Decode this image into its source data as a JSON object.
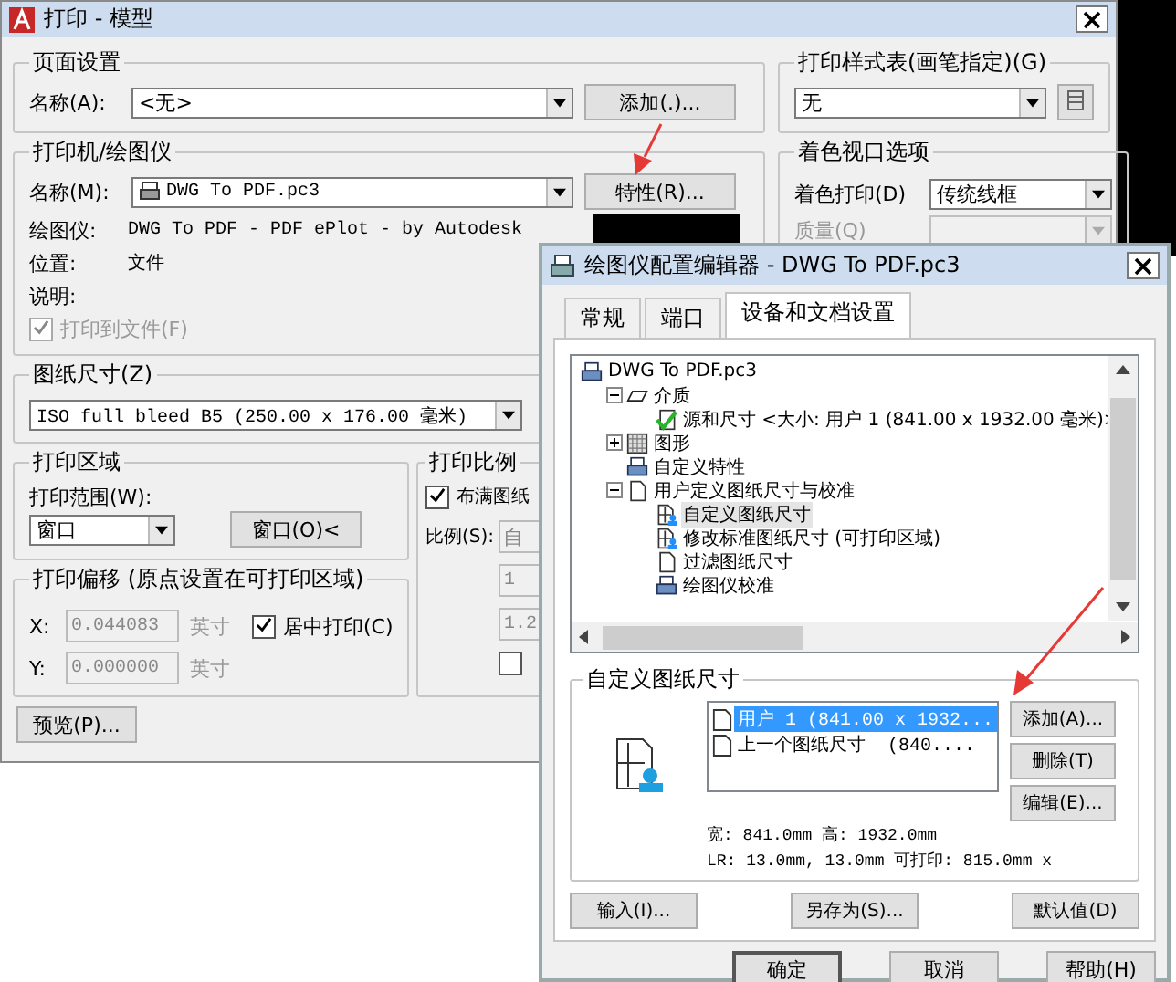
{
  "print_dialog": {
    "title": "打印 - 模型",
    "page_setup": {
      "title": "页面设置",
      "name_label": "名称(A):",
      "name_value": "<无>",
      "add_button": "添加(.)..."
    },
    "printer": {
      "title": "打印机/绘图仪",
      "name_label": "名称(M):",
      "name_value": "DWG To PDF.pc3",
      "properties_button": "特性(R)...",
      "info": [
        {
          "label": "绘图仪:",
          "value": "DWG To PDF - PDF ePlot - by Autodesk"
        },
        {
          "label": "位置:",
          "value": "文件"
        },
        {
          "label": "说明:"
        }
      ],
      "print_to_file": {
        "label": "打印到文件(F)",
        "checked": true,
        "disabled": true
      }
    },
    "paper_size": {
      "title": "图纸尺寸(Z)",
      "value": "ISO full bleed B5 (250.00 x 176.00 毫米)"
    },
    "print_area": {
      "title": "打印区域",
      "range_label": "打印范围(W):",
      "range_value": "窗口",
      "window_button": "窗口(O)<"
    },
    "print_offset": {
      "title": "打印偏移 (原点设置在可打印区域)",
      "fields": [
        {
          "label": "X:",
          "value": "0.044083",
          "unit": "英寸",
          "disabled": true
        },
        {
          "label": "Y:",
          "value": "0.000000",
          "unit": "英寸",
          "disabled": true
        }
      ],
      "center": {
        "label": "居中打印(C)",
        "checked": true
      }
    },
    "print_scale": {
      "title": "打印比例",
      "fit": {
        "label": "布满图纸",
        "checked": true
      },
      "scale_label": "比例(S):",
      "scale_value": "自",
      "fields": [
        "1",
        "1.2"
      ],
      "option": {
        "checked": false
      }
    },
    "preview_button": "预览(P)...",
    "plot_style": {
      "title": "打印样式表(画笔指定)(G)",
      "value": "无"
    },
    "shaded_viewport": {
      "title": "着色视口选项",
      "rows": [
        {
          "label": "着色打印(D)",
          "value": "传统线框",
          "disabled": false
        },
        {
          "label": "质量(Q)",
          "disabled": true
        }
      ]
    }
  },
  "editor_dialog": {
    "title": "绘图仪配置编辑器 - DWG To PDF.pc3",
    "tabs": [
      {
        "label": "常规",
        "selected": false
      },
      {
        "label": "端口",
        "selected": false
      },
      {
        "label": "设备和文档设置",
        "selected": true
      }
    ],
    "tree": [
      {
        "label": "DWG To PDF.pc3",
        "kind": "plotter",
        "selected": false,
        "children": [
          {
            "label": "介质",
            "kind": "media",
            "expanded": true,
            "selected": false,
            "children": [
              {
                "label": "源和尺寸 <大小: 用户 1 (841.00 x 1932.00 毫米)>",
                "kind": "check",
                "selected": false
              }
            ]
          },
          {
            "label": "图形",
            "kind": "graphics",
            "expanded": false,
            "selected": false
          },
          {
            "label": "自定义特性",
            "kind": "printer",
            "selected": false
          },
          {
            "label": "用户定义图纸尺寸与校准",
            "kind": "page",
            "expanded": true,
            "selected": false,
            "children": [
              {
                "label": "自定义图纸尺寸",
                "kind": "user-page",
                "selected": true
              },
              {
                "label": "修改标准图纸尺寸 (可打印区域)",
                "kind": "user-page",
                "selected": false
              },
              {
                "label": "过滤图纸尺寸",
                "kind": "page",
                "selected": false
              },
              {
                "label": "绘图仪校准",
                "kind": "printer",
                "selected": false
              }
            ]
          }
        ]
      }
    ],
    "custom_paper": {
      "title": "自定义图纸尺寸",
      "items": [
        {
          "label": "用户 1 (841.00 x 1932...",
          "selected": true
        },
        {
          "label": "上一个图纸尺寸  (840....",
          "selected": false
        }
      ],
      "buttons": [
        "添加(A)...",
        "删除(T)",
        "编辑(E)..."
      ],
      "info": [
        "宽: 841.0mm 高: 1932.0mm",
        "LR: 13.0mm, 13.0mm 可打印: 815.0mm x"
      ]
    },
    "actions": [
      "输入(I)...",
      "另存为(S)...",
      "默认值(D)"
    ],
    "footer_buttons": [
      "确定",
      "取消",
      "帮助(H)"
    ]
  }
}
